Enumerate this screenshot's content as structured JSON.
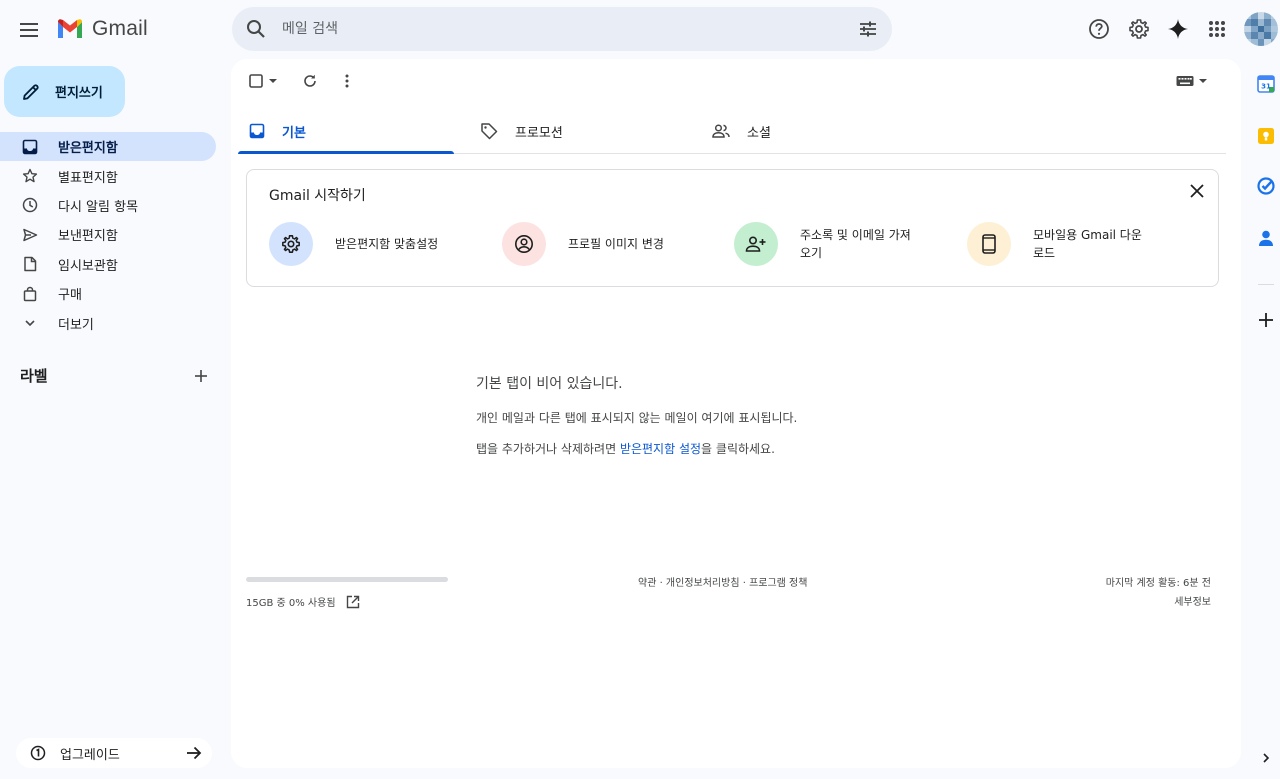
{
  "header": {
    "app_name": "Gmail",
    "search_placeholder": "메일 검색"
  },
  "sidebar": {
    "compose_label": "편지쓰기",
    "items": [
      {
        "label": "받은편지함",
        "active": true,
        "icon": "inbox-icon"
      },
      {
        "label": "별표편지함",
        "active": false,
        "icon": "star-icon"
      },
      {
        "label": "다시 알림 항목",
        "active": false,
        "icon": "clock-icon"
      },
      {
        "label": "보낸편지함",
        "active": false,
        "icon": "send-icon"
      },
      {
        "label": "임시보관함",
        "active": false,
        "icon": "draft-icon"
      },
      {
        "label": "구매",
        "active": false,
        "icon": "shopping-bag-icon"
      },
      {
        "label": "더보기",
        "active": false,
        "icon": "chevron-down-icon"
      }
    ],
    "labels_title": "라벨",
    "upgrade_label": "업그레이드"
  },
  "tabs": [
    {
      "label": "기본",
      "active": true,
      "icon": "inbox-icon"
    },
    {
      "label": "프로모션",
      "active": false,
      "icon": "tag-icon"
    },
    {
      "label": "소셜",
      "active": false,
      "icon": "people-icon"
    }
  ],
  "start_card": {
    "title": "Gmail 시작하기",
    "steps": [
      {
        "label": "받은편지함 맞춤설정",
        "icon": "gear-icon",
        "color": "#d3e3fd"
      },
      {
        "label": "프로필 이미지 변경",
        "icon": "account-circle-icon",
        "color": "#fce2e0"
      },
      {
        "label": "주소록 및 이메일 가져오기",
        "icon": "person-add-icon",
        "color": "#c4eed0"
      },
      {
        "label": "모바일용 Gmail 다운로드",
        "icon": "phone-icon",
        "color": "#fef0d4"
      }
    ]
  },
  "empty_state": {
    "title": "기본 탭이 비어 있습니다.",
    "line1": "개인 메일과 다른 탭에 표시되지 않는 메일이 여기에 표시됩니다.",
    "line2_before": "탭을 추가하거나 삭제하려면 ",
    "line2_link": "받은편지함 설정",
    "line2_after": "을 클릭하세요."
  },
  "footer": {
    "storage_text": "15GB 중 0% 사용됨",
    "storage_percent": 0,
    "links": "약관 · 개인정보처리방침 · 프로그램 정책",
    "last_activity": "마지막 계정 활동: 6분 전",
    "details": "세부정보"
  },
  "colors": {
    "accent": "#0b57d0",
    "compose_bg": "#c2e7ff",
    "active_nav_bg": "#d3e3fd"
  }
}
